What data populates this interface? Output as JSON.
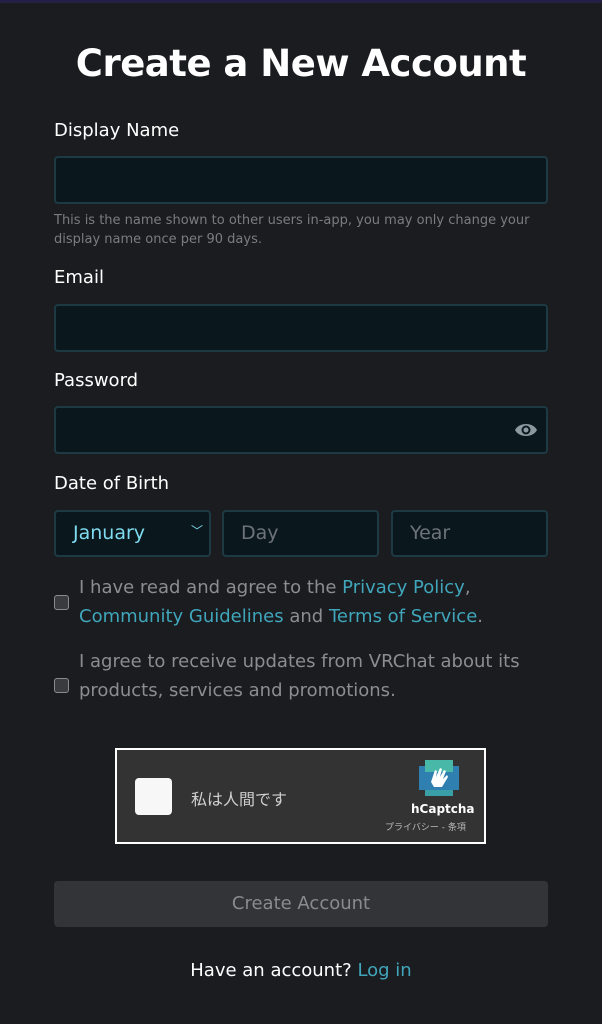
{
  "title": "Create a New Account",
  "display_name": {
    "label": "Display Name",
    "value": "",
    "help": "This is the name shown to other users in-app, you may only change your display name once per 90 days."
  },
  "email": {
    "label": "Email",
    "value": ""
  },
  "password": {
    "label": "Password",
    "value": "",
    "icon": "eye-icon"
  },
  "dob": {
    "label": "Date of Birth",
    "month": "January",
    "day_placeholder": "Day",
    "year_placeholder": "Year"
  },
  "agree_terms": {
    "prefix": "I have read and agree to the ",
    "privacy": "Privacy Policy",
    "comma": ",",
    "guidelines": "Community Guidelines",
    "and": " and ",
    "tos": "Terms of Service",
    "period": ".",
    "checked": false
  },
  "agree_updates": {
    "text": "I agree to receive updates from VRChat about its products, services and promotions.",
    "checked": false
  },
  "captcha": {
    "label": "私は人間です",
    "brand": "hCaptcha",
    "privacy": "プライバシー",
    "sep": " - ",
    "terms": "条項"
  },
  "submit": "Create Account",
  "footer": {
    "prompt": "Have an account? ",
    "login": "Log in"
  },
  "colors": {
    "accent": "#3fa6bb",
    "background": "#1b1c20",
    "input_bg": "#0a181d"
  }
}
